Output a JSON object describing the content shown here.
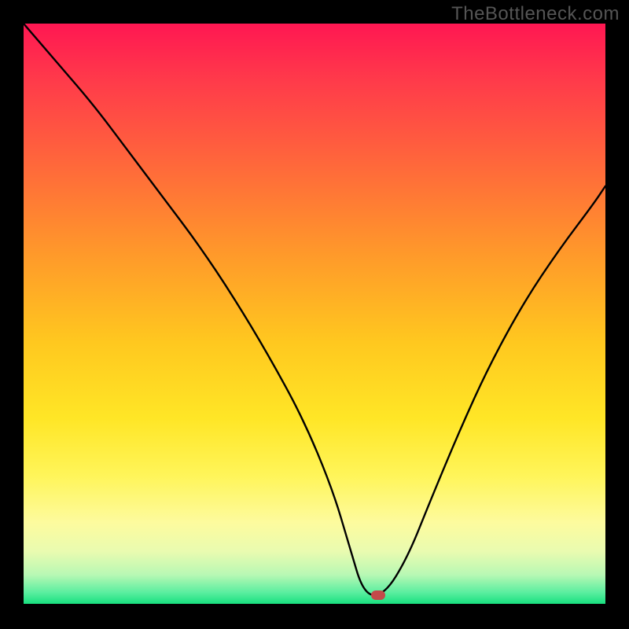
{
  "watermark": "TheBottleneck.com",
  "colors": {
    "page_bg": "#000000",
    "curve": "#000000",
    "marker": "#c24a4a",
    "watermark": "#555555"
  },
  "chart_data": {
    "type": "line",
    "title": "",
    "xlabel": "",
    "ylabel": "",
    "xlim": [
      0,
      100
    ],
    "ylim": [
      0,
      100
    ],
    "grid": false,
    "legend": false,
    "series": [
      {
        "name": "bottleneck-curve",
        "x": [
          0,
          6,
          12,
          18,
          24,
          30,
          36,
          42,
          48,
          53,
          56,
          58.5,
          62,
          66,
          70,
          75,
          80,
          86,
          92,
          98,
          100
        ],
        "values": [
          100,
          93,
          86,
          78,
          70,
          62,
          53,
          43,
          32,
          20,
          10,
          1.5,
          1.5,
          8,
          18,
          30,
          41,
          52,
          61,
          69,
          72
        ]
      }
    ],
    "marker": {
      "x": 61,
      "y": 1.5
    },
    "gradient_stops": [
      {
        "pos": 0,
        "color": "#ff1752"
      },
      {
        "pos": 10,
        "color": "#ff3b4a"
      },
      {
        "pos": 25,
        "color": "#ff6a3a"
      },
      {
        "pos": 40,
        "color": "#ff9a2a"
      },
      {
        "pos": 55,
        "color": "#ffc81f"
      },
      {
        "pos": 68,
        "color": "#ffe626"
      },
      {
        "pos": 78,
        "color": "#fff55a"
      },
      {
        "pos": 86,
        "color": "#fdfb9e"
      },
      {
        "pos": 91,
        "color": "#e9fbb0"
      },
      {
        "pos": 95,
        "color": "#b8f8b4"
      },
      {
        "pos": 98,
        "color": "#5ceea0"
      },
      {
        "pos": 100,
        "color": "#18e07f"
      }
    ]
  }
}
